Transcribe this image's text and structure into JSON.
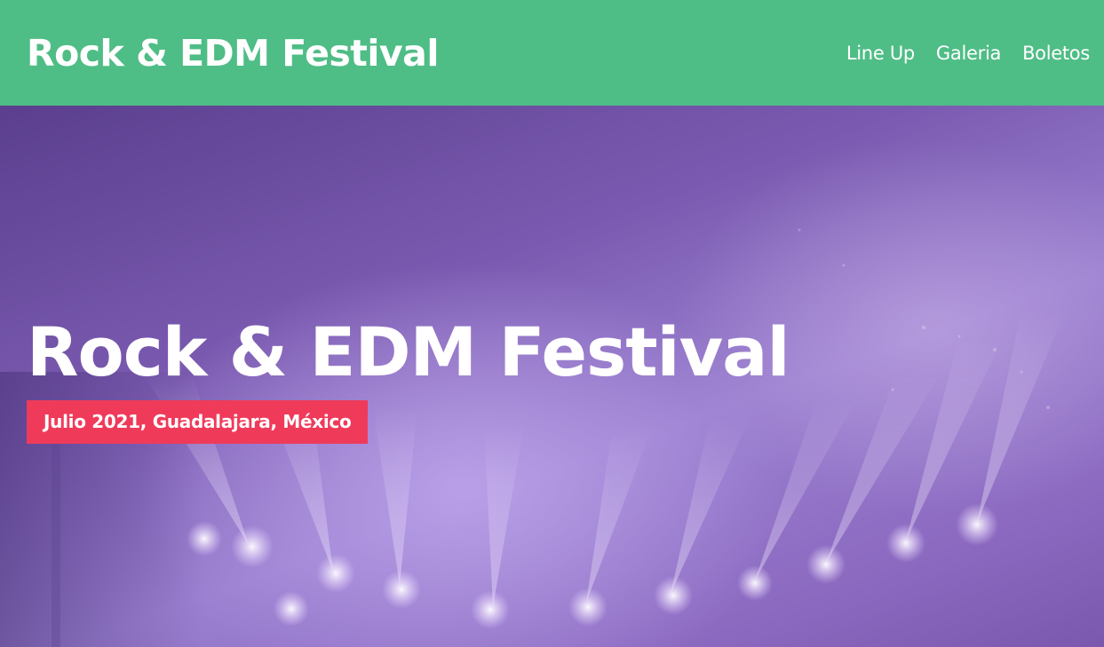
{
  "header": {
    "brand": "Rock & EDM Festival",
    "background_color": "#4fbd86",
    "nav": [
      {
        "label": "Line Up"
      },
      {
        "label": "Galeria"
      },
      {
        "label": "Boletos"
      }
    ]
  },
  "hero": {
    "title": "Rock & EDM Festival",
    "badge": "Julio 2021, Guadalajara, México",
    "badge_color": "#f03a5a",
    "background": "purple concert stage with spotlights"
  }
}
